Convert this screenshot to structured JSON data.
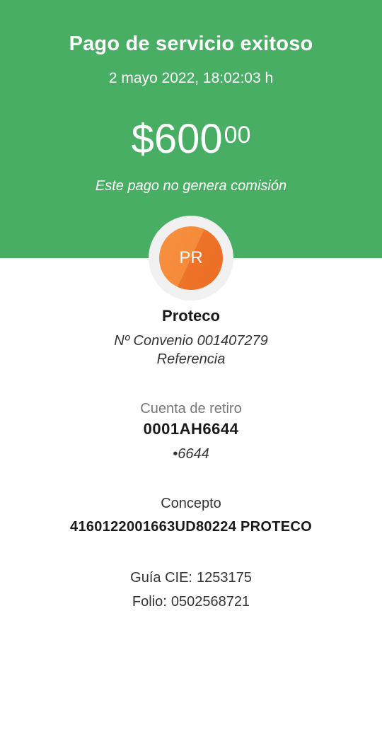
{
  "header": {
    "title": "Pago de servicio exitoso",
    "datetime": "2 mayo 2022, 18:02:03 h",
    "amount_int": "$600",
    "amount_cents": "00",
    "commission_note": "Este pago no genera comisión",
    "background_color": "#48ae63"
  },
  "service": {
    "avatar_initials": "PR",
    "avatar_color": "#f0802f",
    "name": "Proteco",
    "convenio": "Nº Convenio 001407279",
    "referencia": "Referencia"
  },
  "account": {
    "label": "Cuenta de retiro",
    "value": "0001AH6644",
    "masked": "•6644"
  },
  "concept": {
    "label": "Concepto",
    "value": "4160122001663UD80224 PROTECO"
  },
  "refs": {
    "guia_label": "Guía CIE:",
    "guia_value": "1253175",
    "folio_label": "Folio:",
    "folio_value": "0502568721"
  }
}
